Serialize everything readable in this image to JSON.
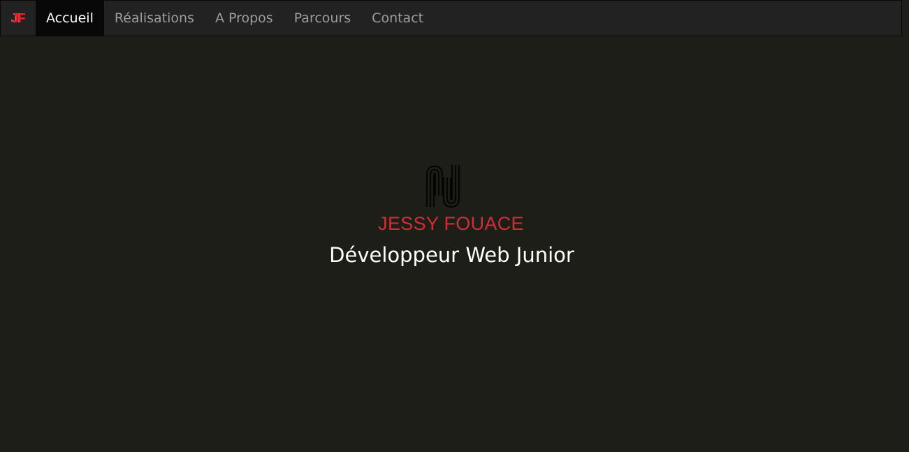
{
  "brand": {
    "logo_text": "JF",
    "accent_color": "#e0282f"
  },
  "nav": {
    "items": [
      {
        "label": "Accueil",
        "active": true
      },
      {
        "label": "Réalisations",
        "active": false
      },
      {
        "label": "A Propos",
        "active": false
      },
      {
        "label": "Parcours",
        "active": false
      },
      {
        "label": "Contact",
        "active": false
      }
    ]
  },
  "hero": {
    "name": "JESSY FOUACE",
    "name_color": "#d42c35",
    "subtitle": "Développeur Web Junior",
    "monogram_icon": "jf-monogram-icon"
  },
  "colors": {
    "background": "#1e1e19",
    "navbar": "#222222",
    "nav_active": "#080808",
    "nav_text": "#9d9d9d"
  }
}
